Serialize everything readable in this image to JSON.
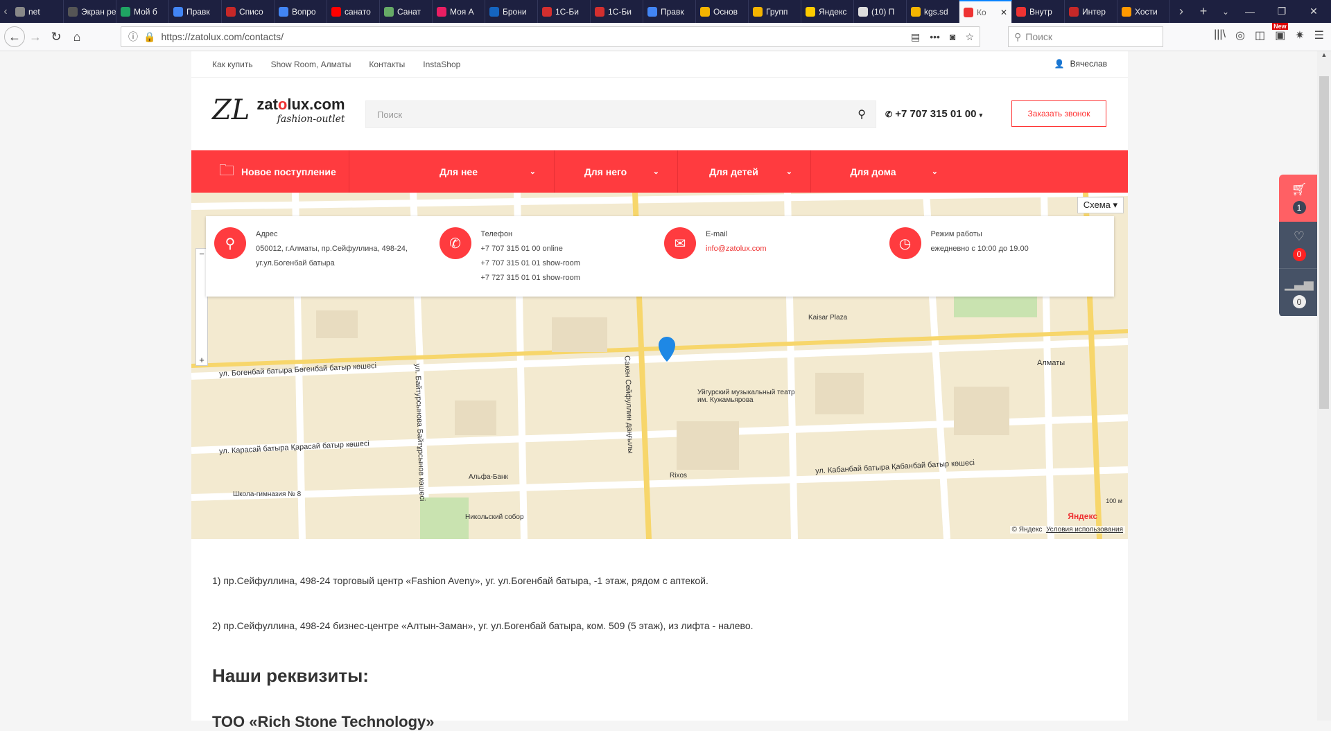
{
  "browser": {
    "tabs": [
      {
        "label": "net",
        "color": "#888"
      },
      {
        "label": "Экран рег",
        "color": "#555"
      },
      {
        "label": "Мой б",
        "color": "#1fa463"
      },
      {
        "label": "Правк",
        "color": "#4285f4"
      },
      {
        "label": "Списо",
        "color": "#c62828"
      },
      {
        "label": "Вопро",
        "color": "#4285f4"
      },
      {
        "label": "санато",
        "color": "#f00"
      },
      {
        "label": "Санат",
        "color": "#6a6"
      },
      {
        "label": "Моя А",
        "color": "#e91e63"
      },
      {
        "label": "Брони",
        "color": "#1565c0"
      },
      {
        "label": "1С-Би",
        "color": "#d32f2f"
      },
      {
        "label": "1С-Би",
        "color": "#d32f2f"
      },
      {
        "label": "Правк",
        "color": "#4285f4"
      },
      {
        "label": "Основ",
        "color": "#f4b400"
      },
      {
        "label": "Групп",
        "color": "#f4b400"
      },
      {
        "label": "Яндекс",
        "color": "#fc0"
      },
      {
        "label": "(10) П",
        "color": "#ddd"
      },
      {
        "label": "kgs.sd",
        "color": "#f4b400"
      },
      {
        "label": "Ко",
        "color": "#e33",
        "active": true
      },
      {
        "label": "Внутр",
        "color": "#e33"
      },
      {
        "label": "Интер",
        "color": "#c62828"
      },
      {
        "label": "Хости",
        "color": "#f90"
      }
    ],
    "url": "https://zatolux.com/contacts/",
    "search_placeholder": "Поиск",
    "new_badge": "New"
  },
  "site": {
    "toplinks": [
      "Как купить",
      "Show Room, Алматы",
      "Контакты",
      "InstaShop"
    ],
    "user": "Вячеслав",
    "logo": {
      "monogram": "ZL",
      "name_pre": "zat",
      "name_o": "o",
      "name_post": "lux.com",
      "tagline": "fashion-outlet"
    },
    "search_placeholder": "Поиск",
    "phone": "+7 707 315 01 00",
    "call_button": "Заказать звонок",
    "menu": [
      "Новое поступление",
      "Для нее",
      "Для него",
      "Для детей",
      "Для дома"
    ],
    "accent": "#ff3b3f"
  },
  "map": {
    "schema_button": "Схема ▾",
    "copyright": "© Яндекс",
    "terms": "Условия использования",
    "yandex": "Яндекс",
    "scale": "100 м",
    "labels": [
      "ул. Богенбай батыра Бөгенбай батыр көшесі",
      "ул. Карасай батыра Қарасай батыр көшесі",
      "ул. Кабанбай батыра Қабанбай батыр көшесі",
      "Сакен Сейфуллин даңғылы",
      "ул. Байтурсынова Байтұрсынов көшесі",
      "Алматы",
      "Kaisar Plaza",
      "Rixos",
      "Альфа-Банк",
      "Никольский собор",
      "Уйгурский музыкальный театр им. Кужамьярова",
      "Школа-гимназия № 8"
    ]
  },
  "contacts": [
    {
      "icon": "map-pin",
      "title": "Адрес",
      "lines": [
        "050012, г.Алматы, пр.Сейфуллина, 498-24,",
        "уг.ул.Богенбай батыра"
      ]
    },
    {
      "icon": "phone",
      "title": "Телефон",
      "lines": [
        "+7 707 315 01 00 online",
        "+7 707 315 01 01 show-room",
        "+7 727 315 01 01 show-room"
      ]
    },
    {
      "icon": "envelope",
      "title": "E-mail",
      "link": "info@zatolux.com"
    },
    {
      "icon": "clock",
      "title": "Режим работы",
      "lines": [
        "ежедневно с 10:00 до 19.00"
      ]
    }
  ],
  "content": {
    "p1": "1) пр.Сейфуллина, 498-24 торговый центр «Fashion Aveny», уг. ул.Богенбай батыра, -1 этаж, рядом с аптекой.",
    "p2": "2) пр.Сейфуллина, 498-24 бизнес-центре «Алтын-Заман», уг. ул.Богенбай батыра, ком. 509 (5 этаж), из лифта - налево.",
    "h2": "Наши реквизиты:",
    "h3": "ТОО «Rich Stone Technology»"
  },
  "sidebar": {
    "cart": "1",
    "wishlist": "0",
    "compare": "0"
  }
}
